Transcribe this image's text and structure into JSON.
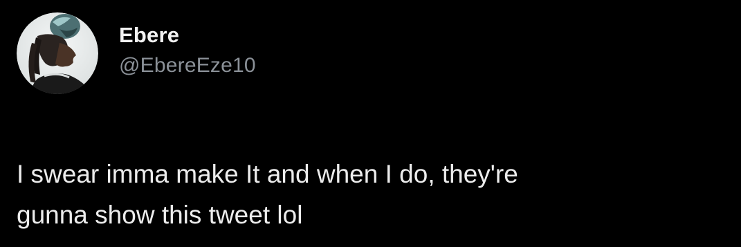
{
  "tweet": {
    "author": {
      "display_name": "Ebere",
      "handle": "@EbereEze10",
      "avatar_icon": "profile-photo-avatar"
    },
    "text_line_1": "I swear imma make It and when I do, they're",
    "text_line_2": "gunna show this tweet lol"
  },
  "colors": {
    "background": "#000000",
    "name": "#f2f2f2",
    "handle": "#8b9198",
    "text": "#ececec"
  }
}
